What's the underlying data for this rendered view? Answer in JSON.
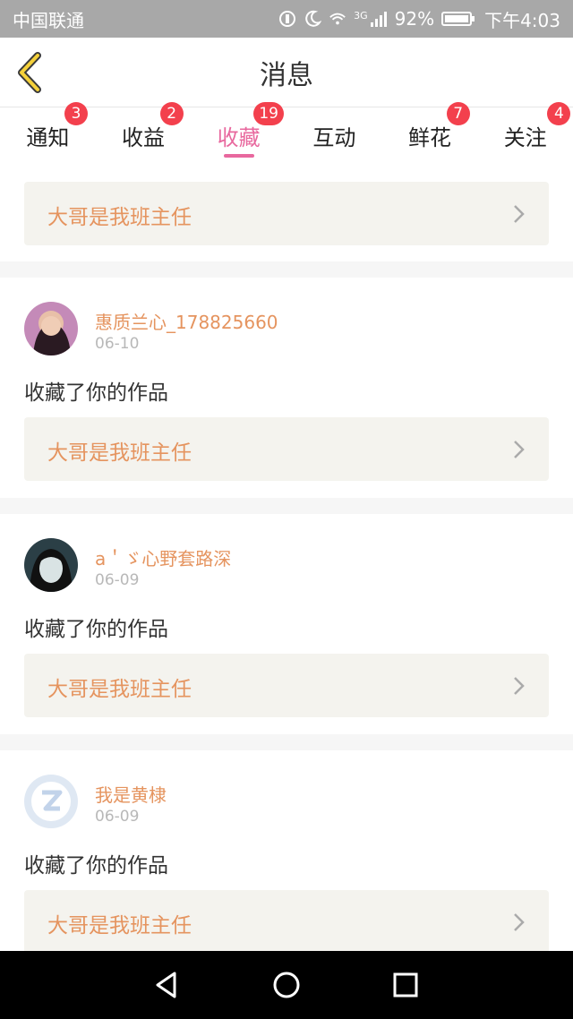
{
  "status_bar": {
    "carrier": "中国联通",
    "battery": "92%",
    "time": "下午4:03",
    "network": "3G"
  },
  "header": {
    "title": "消息"
  },
  "tabs": [
    {
      "label": "通知",
      "badge": "3"
    },
    {
      "label": "收益",
      "badge": "2"
    },
    {
      "label": "收藏",
      "badge": "19",
      "active": true
    },
    {
      "label": "互动",
      "badge": ""
    },
    {
      "label": "鲜花",
      "badge": "7"
    },
    {
      "label": "关注",
      "badge": "4"
    }
  ],
  "top_item": {
    "work_title": "大哥是我班主任"
  },
  "items": [
    {
      "user": "惠质兰心_178825660",
      "date": "06-10",
      "action": "收藏了你的作品",
      "work_title": "大哥是我班主任"
    },
    {
      "user": "a＇ゞ心野套路深",
      "date": "06-09",
      "action": "收藏了你的作品",
      "work_title": "大哥是我班主任"
    },
    {
      "user": "我是黄棣",
      "date": "06-09",
      "action": "收藏了你的作品",
      "work_title": "大哥是我班主任"
    }
  ],
  "colors": {
    "accent_pink": "#e8689e",
    "badge_red": "#f3404d",
    "name_orange": "#e5945f",
    "work_bg": "#f4f3ee"
  },
  "icons": [
    "back-arrow-icon",
    "chevron-right-icon",
    "nav-back-icon",
    "nav-home-icon",
    "nav-recent-icon"
  ]
}
